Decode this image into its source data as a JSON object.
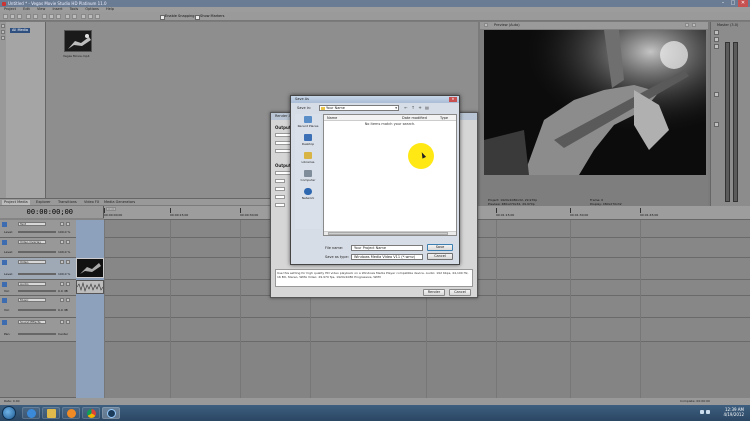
{
  "window": {
    "title": "Untitled * - Vegas Movie Studio HD Platinum 11.0",
    "controls": [
      "–",
      "□",
      "✕"
    ]
  },
  "menu": [
    "Project",
    "Edit",
    "View",
    "Insert",
    "Tools",
    "Options",
    "Help"
  ],
  "toolbar": {
    "checks": [
      "Enable Snapping",
      "Show Markers"
    ]
  },
  "media": {
    "tree_root": "All Media",
    "thumb_caption": "Vegas Movie.mp4"
  },
  "panel_tabs": [
    "Project Media",
    "Explorer",
    "Transitions",
    "Video FX",
    "Media Generators"
  ],
  "preview": {
    "label": "Preview (Auto)",
    "info_left": [
      "Project: 1920x1080x32, 29.970p",
      "Preview: 480x270x32, 29.970p",
      "Video Preview"
    ],
    "info_right": [
      "Frame: 0",
      "Display: 480x270x32"
    ]
  },
  "master": {
    "label": "Master (3.0)"
  },
  "timeline": {
    "time": "00:00:00;00",
    "marker_label": "00:00",
    "ticks": [
      "00:00:00;00",
      "00:00:15;00",
      "00:00:30;00",
      "00:00:45;00",
      "00:01:00;00",
      "00:01:15;00",
      "00:01:30;00",
      "00:01:45;00"
    ],
    "tracks": [
      {
        "name": "Text",
        "level_label": "Level:",
        "level": "100.0 %"
      },
      {
        "name": "Video Overlay",
        "level_label": "Level:",
        "level": "100.0 %"
      },
      {
        "name": "Video",
        "level_label": "Level:",
        "level": "100.0 %"
      },
      {
        "name": "Audio",
        "level_label": "Vol:",
        "level": "0.0 dB"
      },
      {
        "name": "Music",
        "level_label": "Vol:",
        "level": "0.0 dB"
      },
      {
        "name": "Sound Effects",
        "level_label": "Pan:",
        "level": "Center"
      }
    ],
    "status_left": "Rate: 0.00",
    "status_right": "Complete: 00:00:00"
  },
  "render_dialog": {
    "title": "Render As",
    "section1": "Output File",
    "section2": "Output Format",
    "description": "Use this setting for high quality HD video playback on a Windows Media Player compatible device. Audio: 192 Kbps, 44,100 Hz, 16 Bit, Stereo, WMA Video: 29.970 fps, 1920x1080 Progressive, WMV",
    "buttons": [
      "Render",
      "Cancel"
    ]
  },
  "save_dialog": {
    "title": "Save As",
    "close": "✕",
    "save_in_label": "Save in:",
    "save_in_value": "Your Name",
    "places": [
      "Recent Places",
      "Desktop",
      "Libraries",
      "Computer",
      "Network"
    ],
    "columns": [
      "Name",
      "Date modified",
      "Type"
    ],
    "empty_message": "No items match your search.",
    "file_name_label": "File name:",
    "file_name_value": "Your Project Name",
    "save_type_label": "Save as type:",
    "save_type_value": "Windows Media Video V11 (*.wmv)",
    "save_button": "Save",
    "cancel_button": "Cancel"
  },
  "taskbar": {
    "apps": [
      "Internet Explorer",
      "Windows Explorer",
      "Media Player",
      "Google Chrome",
      "Vegas Movie Studio"
    ],
    "time": "12:39 AM",
    "date": "4/19/2012"
  }
}
